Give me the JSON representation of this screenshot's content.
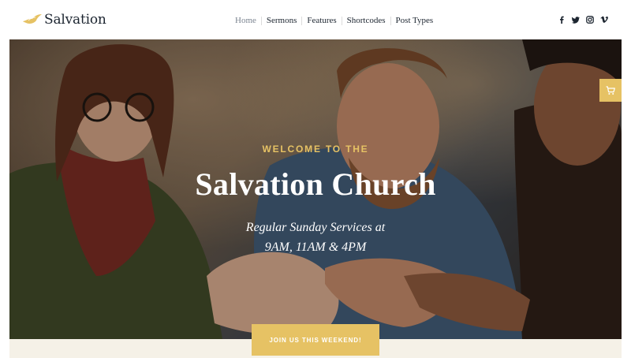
{
  "site": {
    "logo_text": "Salvation"
  },
  "nav": {
    "items": [
      {
        "label": "Home",
        "active": true
      },
      {
        "label": "Sermons",
        "active": false
      },
      {
        "label": "Features",
        "active": false
      },
      {
        "label": "Shortcodes",
        "active": false
      },
      {
        "label": "Post Types",
        "active": false
      }
    ]
  },
  "social": [
    {
      "icon": "facebook-icon"
    },
    {
      "icon": "twitter-icon"
    },
    {
      "icon": "instagram-icon"
    },
    {
      "icon": "vimeo-icon"
    }
  ],
  "hero": {
    "kicker": "WELCOME TO THE",
    "title": "Salvation Church",
    "subtitle_line1": "Regular Sunday Services at",
    "subtitle_line2": "9AM, 11AM & 4PM",
    "cta_label": "JOIN US THIS WEEKEND!"
  },
  "cart": {
    "icon": "shopping-cart-icon"
  },
  "colors": {
    "accent": "#e6c264",
    "text_dark": "#1c2530",
    "nav_active": "#7c8591",
    "band": "#f5f1e7"
  }
}
